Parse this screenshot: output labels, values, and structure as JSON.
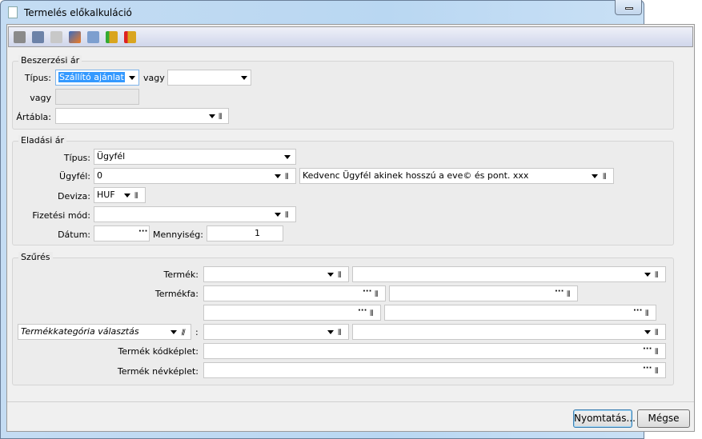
{
  "window": {
    "title": "Termelés előkalkuláció"
  },
  "toolbar": {
    "icons": [
      "print-icon",
      "print-preview-icon",
      "copy-icon",
      "edit-icon",
      "calculator-icon",
      "database-refresh-icon",
      "database-undo-icon"
    ]
  },
  "beszerzesi": {
    "legend": "Beszerzési ár",
    "tipus_label": "Típus:",
    "tipus_value": "Szállító ajánlat",
    "vagy1": "vagy",
    "vagy2": "vagy",
    "artabla_label": "Ártábla:"
  },
  "eladasi": {
    "legend": "Eladási ár",
    "tipus_label": "Típus:",
    "tipus_value": "Ügyfél",
    "ugyfel_label": "Ügyfél:",
    "ugyfel_value": "0",
    "ugyfel_name": "Kedvenc Ügyfél akinek hosszú a eve© és pont. xxx",
    "deviza_label": "Deviza:",
    "deviza_value": "HUF",
    "fizmod_label": "Fizetési mód:",
    "datum_label": "Dátum:",
    "mennyiseg_label": "Mennyiség:",
    "mennyiseg_value": "1"
  },
  "szures": {
    "legend": "Szűrés",
    "termek_label": "Termék:",
    "termekfa_label": "Termékfa:",
    "kategoria_value": "Termékkategória választás",
    "colon": ":",
    "kodkeplet_label": "Termék kódképlet:",
    "nevkeplet_label": "Termék névképlet:"
  },
  "buttons": {
    "print": "Nyomtatás...",
    "cancel": "Mégse"
  }
}
